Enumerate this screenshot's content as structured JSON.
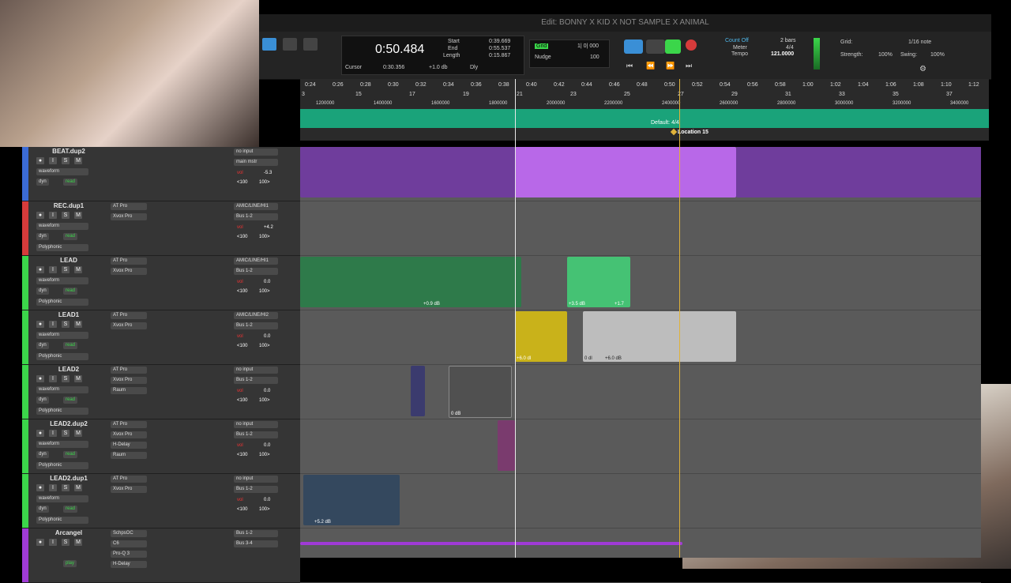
{
  "window": {
    "title": "Edit: BONNY X KID X NOT SAMPLE X ANIMAL"
  },
  "transport": {
    "main_counter": "0:50.484",
    "start_label": "Start",
    "end_label": "End",
    "length_label": "Length",
    "start": "0:39.669",
    "end": "0:55.537",
    "length": "0:15.867",
    "cursor_label": "Cursor",
    "cursor": "0:30.356",
    "gain": "+1.0 db",
    "dly": "Dly",
    "grid_label": "Grid",
    "grid_value": "1| 0| 000",
    "nudge_label": "Nudge",
    "nudge_value": "100",
    "count_off": "Count Off",
    "count_off_value": "2 bars",
    "meter_label": "Meter",
    "meter_value": "4/4",
    "tempo_label": "Tempo",
    "tempo_value": "121.0000",
    "grid_setting_label": "Grid:",
    "grid_setting_value": "1/16 note",
    "strength_label": "Strength:",
    "strength_value": "100%",
    "swing_label": "Swing:",
    "swing_value": "100%"
  },
  "ruler": {
    "times": [
      "0:24",
      "0:26",
      "0:28",
      "0:30",
      "0:32",
      "0:34",
      "0:36",
      "0:38",
      "0:40",
      "0:42",
      "0:44",
      "0:46",
      "0:48",
      "0:50",
      "0:52",
      "0:54",
      "0:56",
      "0:58",
      "1:00",
      "1:02",
      "1:04",
      "1:06",
      "1:08",
      "1:10",
      "1:12"
    ],
    "bars": [
      "3",
      "15",
      "17",
      "19",
      "21",
      "23",
      "25",
      "27",
      "29",
      "31",
      "33",
      "35",
      "37"
    ],
    "samples": [
      "1200000",
      "1400000",
      "1600000",
      "1800000",
      "2000000",
      "2200000",
      "2400000",
      "2600000",
      "2800000",
      "3000000",
      "3200000",
      "3400000"
    ],
    "meter_marker": "Default: 4/4",
    "location_marker": "Location 15"
  },
  "tracks": [
    {
      "name": "BEAT.dup2",
      "color": "#3b6bd6",
      "insert1": "",
      "insert2": "",
      "input": "no input",
      "output": "main mstr",
      "vol": "-5.3",
      "pan_l": "<100",
      "pan_r": "100>",
      "view": "waveform",
      "mode": "dyn",
      "auto": "read",
      "extra": ""
    },
    {
      "name": "REC.dup1",
      "color": "#d63b3b",
      "insert1": "AT Pro",
      "insert2": "Xvox Pro",
      "input": "AMIC/LINE/HI1",
      "output": "Bus 1-2",
      "vol": "+4.2",
      "pan_l": "<100",
      "pan_r": "100>",
      "view": "waveform",
      "mode": "dyn",
      "auto": "read",
      "extra": "Polyphonic"
    },
    {
      "name": "LEAD",
      "color": "#3bd64a",
      "insert1": "AT Pro",
      "insert2": "Xvox Pro",
      "input": "AMIC/LINE/HI1",
      "output": "Bus 1-2",
      "vol": "0.0",
      "pan_l": "<100",
      "pan_r": "100>",
      "view": "waveform",
      "mode": "dyn",
      "auto": "read",
      "extra": "Polyphonic"
    },
    {
      "name": "LEAD1",
      "color": "#3bd64a",
      "insert1": "AT Pro",
      "insert2": "Xvox Pro",
      "input": "AMIC/LINE/HI2",
      "output": "Bus 1-2",
      "vol": "0.0",
      "pan_l": "<100",
      "pan_r": "100>",
      "view": "waveform",
      "mode": "dyn",
      "auto": "read",
      "extra": "Polyphonic"
    },
    {
      "name": "LEAD2",
      "color": "#3bd64a",
      "insert1": "AT Pro",
      "insert2": "Xvox Pro",
      "insert3": "Raum",
      "input": "no input",
      "output": "Bus 1-2",
      "vol": "0.0",
      "pan_l": "<100",
      "pan_r": "100>",
      "view": "waveform",
      "mode": "dyn",
      "auto": "read",
      "extra": "Polyphonic"
    },
    {
      "name": "LEAD2.dup2",
      "color": "#3bd64a",
      "insert1": "AT Pro",
      "insert2": "Xvox Pro",
      "insert3": "H-Delay",
      "insert4": "Raum",
      "input": "no input",
      "output": "Bus 1-2",
      "vol": "0.0",
      "pan_l": "<100",
      "pan_r": "100>",
      "view": "waveform",
      "mode": "dyn",
      "auto": "read",
      "extra": "Polyphonic"
    },
    {
      "name": "LEAD2.dup1",
      "color": "#3bd64a",
      "insert1": "AT Pro",
      "insert2": "Xvox Pro",
      "input": "no input",
      "output": "Bus 1-2",
      "vol": "0.0",
      "pan_l": "<100",
      "pan_r": "100>",
      "view": "waveform",
      "mode": "dyn",
      "auto": "read",
      "extra": "Polyphonic"
    },
    {
      "name": "Arcangel",
      "color": "#a03bd6",
      "insert1": "SchpsOC",
      "insert2": "C6",
      "insert3": "Pro-Q 3",
      "insert4": "H-Delay",
      "input": "Bus 1-2",
      "output": "Bus 3-4",
      "vol": "",
      "pan_l": "",
      "pan_r": "",
      "view": "",
      "mode": "",
      "auto": "play",
      "extra": ""
    }
  ],
  "clips": {
    "lead_gain": "+0.9 dB",
    "lead_gain2": "+3.5 dB",
    "lead_gain3": "+1.7",
    "lead1_gain": "+6.0 dl",
    "lead1_gain2": "0 dl",
    "lead1_gain3": "+6.0 dB",
    "lead2_gain": "0 dB",
    "lead2dup1_gain": "+5.2 dB"
  },
  "colors": {
    "beat": "#8a4bc0",
    "lead": "#45c274",
    "lead1": "#c9b21a",
    "lead2": "#3b3b6e",
    "marker": "#1aa37a",
    "playhead": "#e8e8e8",
    "location": "#e0b23a"
  }
}
